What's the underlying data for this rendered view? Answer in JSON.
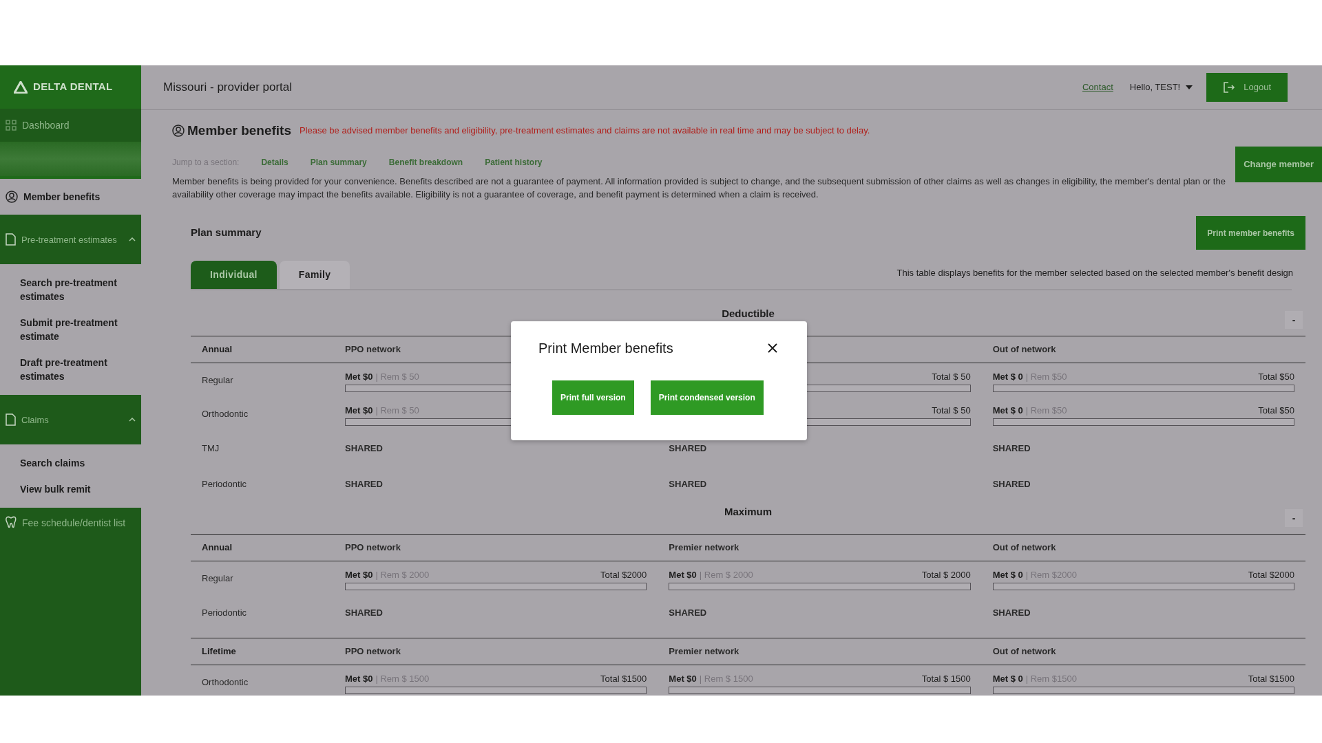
{
  "sidebar": {
    "logo": "DELTA DENTAL",
    "items": [
      {
        "kind": "link",
        "label": "Dashboard",
        "selected": false
      },
      {
        "kind": "page",
        "label": "Member benefits",
        "selected": true
      },
      {
        "kind": "group",
        "label": "Pre-treatment estimates",
        "selected": false,
        "expanded": true,
        "children": [
          {
            "label": "Search pre-treatment estimates",
            "selected": false
          },
          {
            "label": "Submit pre-treatment estimate",
            "selected": false
          },
          {
            "label": "Draft pre-treatment estimates",
            "selected": false
          }
        ]
      },
      {
        "kind": "group",
        "label": "Claims",
        "selected": false,
        "expanded": true,
        "children": [
          {
            "label": "Search claims",
            "selected": false
          },
          {
            "label": "View bulk remit",
            "selected": false
          }
        ]
      },
      {
        "kind": "link",
        "label": "Fee schedule/dentist list",
        "selected": false
      }
    ]
  },
  "header": {
    "title": "Missouri - provider portal",
    "contact": "Contact",
    "user": "Hello, TEST!",
    "logout": "Logout"
  },
  "page": {
    "heading": "Member benefits",
    "notice": "Please be advised member benefits and eligibility, pre-treatment estimates and claims are not available in real time and may be subject to delay.",
    "jump_label": "Jump to a section:",
    "jump_links": [
      "Details",
      "Plan summary",
      "Benefit breakdown",
      "Patient history"
    ],
    "change_member": "Change member",
    "disclaimer": "Member benefits is being provided for your convenience. Benefits described are not a guarantee of payment. All information provided is subject to change, and the subsequent submission of other claims as well as changes in eligibility, the member's dental plan or the availability other coverage may impact the benefits available. Eligibility is not a guarantee of coverage, and benefit payment is determined when a claim is received.",
    "plan_title": "Plan summary",
    "print_button": "Print member benefits",
    "tabs": [
      {
        "label": "Individual",
        "selected": true
      },
      {
        "label": "Family",
        "selected": false
      }
    ],
    "table_note": "This table displays benefits for the member selected based on the selected member's benefit design",
    "sections": [
      {
        "title": "Deductible",
        "toggle": "-",
        "groups": [
          {
            "label": "Annual",
            "headers": [
              {
                "kind": "text",
                "text": "PPO network"
              },
              {
                "kind": "hidden"
              },
              {
                "kind": "text",
                "text": "Out of network"
              }
            ],
            "rows": [
              {
                "label": "Regular",
                "cells": [
                  {
                    "kind": "meter",
                    "met": "Met $0",
                    "rem": "| Rem $ 50",
                    "level": 0
                  },
                  {
                    "kind": "meter",
                    "total": "Total $ 50",
                    "level": 0
                  },
                  {
                    "kind": "meter",
                    "met": "Met $ 0",
                    "rem": "| Rem $50",
                    "total": "Total $50",
                    "level": 0
                  }
                ]
              },
              {
                "label": "Orthodontic",
                "cells": [
                  {
                    "kind": "meter",
                    "met": "Met $0",
                    "rem": "| Rem $ 50",
                    "level": 0
                  },
                  {
                    "kind": "meter",
                    "total": "Total $ 50",
                    "level": 0
                  },
                  {
                    "kind": "meter",
                    "met": "Met $ 0",
                    "rem": "| Rem $50",
                    "total": "Total $50",
                    "level": 0
                  }
                ]
              },
              {
                "label": "TMJ",
                "cells": [
                  {
                    "kind": "text",
                    "text": "SHARED"
                  },
                  {
                    "kind": "text",
                    "text": "SHARED"
                  },
                  {
                    "kind": "text",
                    "text": "SHARED"
                  }
                ]
              },
              {
                "label": "Periodontic",
                "cells": [
                  {
                    "kind": "text",
                    "text": "SHARED"
                  },
                  {
                    "kind": "text",
                    "text": "SHARED"
                  },
                  {
                    "kind": "text",
                    "text": "SHARED"
                  }
                ]
              }
            ]
          }
        ]
      },
      {
        "title": "Maximum",
        "toggle": "-",
        "groups": [
          {
            "label": "Annual",
            "headers": [
              {
                "kind": "text",
                "text": "PPO network"
              },
              {
                "kind": "text",
                "text": "Premier network"
              },
              {
                "kind": "text",
                "text": "Out of network"
              }
            ],
            "rows": [
              {
                "label": "Regular",
                "cells": [
                  {
                    "kind": "meter",
                    "met": "Met $0",
                    "rem": "| Rem $ 2000",
                    "total": "Total $2000",
                    "level": 0
                  },
                  {
                    "kind": "meter",
                    "met": "Met $0",
                    "rem": "| Rem $ 2000",
                    "total": "Total $ 2000",
                    "level": 0
                  },
                  {
                    "kind": "meter",
                    "met": "Met $ 0",
                    "rem": "| Rem $2000",
                    "total": "Total $2000",
                    "level": 0
                  }
                ]
              },
              {
                "label": "Periodontic",
                "cells": [
                  {
                    "kind": "text",
                    "text": "SHARED"
                  },
                  {
                    "kind": "text",
                    "text": "SHARED"
                  },
                  {
                    "kind": "text",
                    "text": "SHARED"
                  }
                ]
              }
            ]
          },
          {
            "label": "Lifetime",
            "headers": [
              {
                "kind": "text",
                "text": "PPO network"
              },
              {
                "kind": "text",
                "text": "Premier network"
              },
              {
                "kind": "text",
                "text": "Out of network"
              }
            ],
            "rows": [
              {
                "label": "Orthodontic",
                "cells": [
                  {
                    "kind": "meter",
                    "met": "Met $0",
                    "rem": "| Rem $ 1500",
                    "total": "Total $1500",
                    "level": 0
                  },
                  {
                    "kind": "meter",
                    "met": "Met $0",
                    "rem": "| Rem $ 1500",
                    "total": "Total $ 1500",
                    "level": 0
                  },
                  {
                    "kind": "meter",
                    "met": "Met $ 0",
                    "rem": "| Rem $1500",
                    "total": "Total $1500",
                    "level": 0
                  }
                ]
              }
            ]
          }
        ]
      }
    ]
  },
  "modal": {
    "title": "Print Member benefits",
    "buttons": [
      "Print full version",
      "Print condensed version"
    ]
  }
}
